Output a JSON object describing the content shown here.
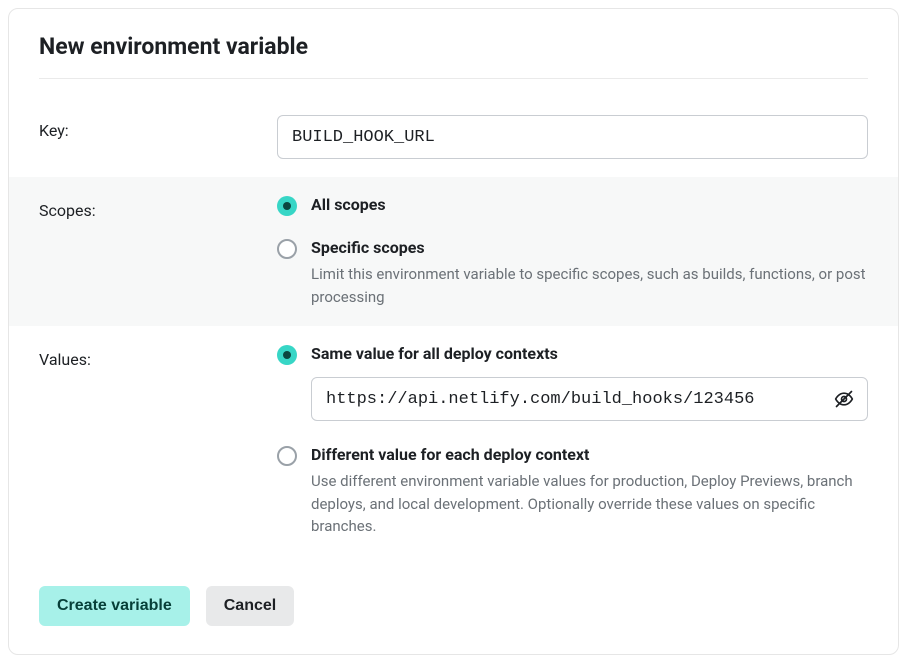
{
  "title": "New environment variable",
  "key": {
    "label": "Key:",
    "value": "BUILD_HOOK_URL"
  },
  "scopes": {
    "label": "Scopes:",
    "options": {
      "all": {
        "label": "All scopes",
        "selected": true
      },
      "specific": {
        "label": "Specific scopes",
        "desc": "Limit this environment variable to specific scopes, such as builds, functions, or post processing",
        "selected": false
      }
    }
  },
  "values": {
    "label": "Values:",
    "options": {
      "same": {
        "label": "Same value for all deploy contexts",
        "value": "https://api.netlify.com/build_hooks/123456",
        "selected": true
      },
      "different": {
        "label": "Different value for each deploy context",
        "desc": "Use different environment variable values for production, Deploy Previews, branch deploys, and local development. Optionally override these values on specific branches.",
        "selected": false
      }
    }
  },
  "buttons": {
    "create": "Create variable",
    "cancel": "Cancel"
  }
}
